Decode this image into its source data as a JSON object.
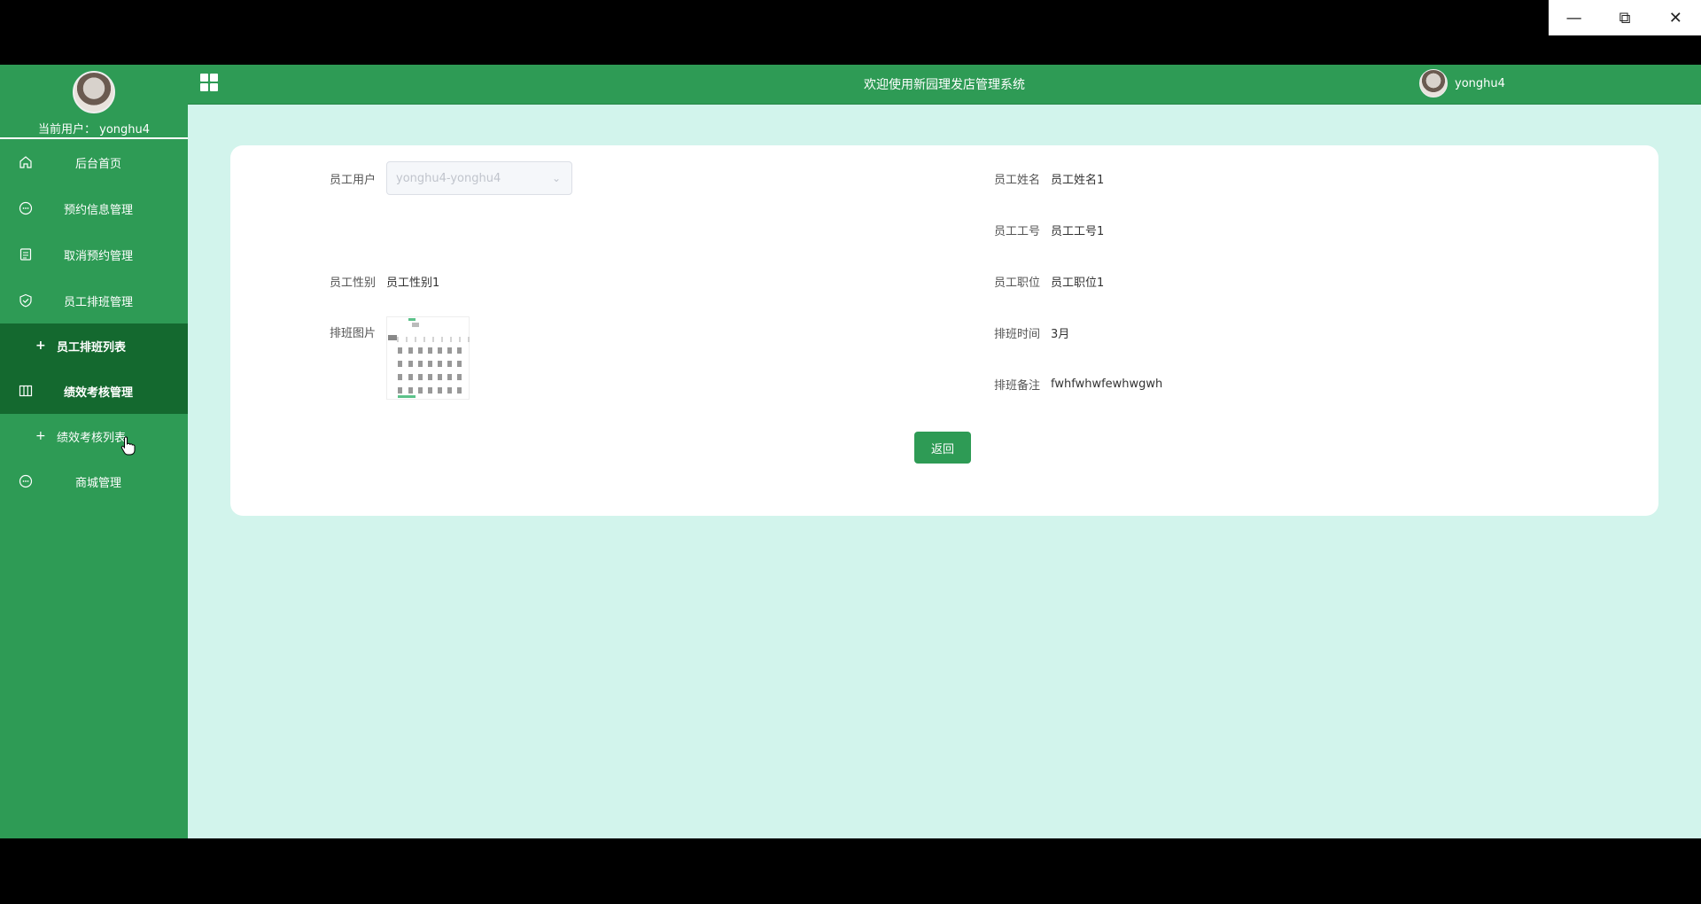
{
  "window": {
    "minimize_icon": "minimize-icon",
    "restore_icon": "restore-icon",
    "close_icon": "close-icon"
  },
  "sidebar": {
    "current_user_label": "当前用户：",
    "current_user": "yonghu4",
    "items": [
      {
        "label": "后台首页",
        "icon": "home-icon"
      },
      {
        "label": "预约信息管理",
        "icon": "chat-icon"
      },
      {
        "label": "取消预约管理",
        "icon": "document-icon"
      },
      {
        "label": "员工排班管理",
        "icon": "shield-icon"
      },
      {
        "label": "员工排班列表",
        "icon": "plus-icon",
        "sub": true
      },
      {
        "label": "绩效考核管理",
        "icon": "columns-icon"
      },
      {
        "label": "绩效考核列表",
        "icon": "plus-icon",
        "sub": true
      },
      {
        "label": "商城管理",
        "icon": "chat-icon"
      }
    ]
  },
  "topbar": {
    "title": "欢迎使用新园理发店管理系统",
    "username": "yonghu4"
  },
  "form": {
    "employee_user": {
      "label": "员工用户",
      "value": "yonghu4-yonghu4"
    },
    "employee_name": {
      "label": "员工姓名",
      "value": "员工姓名1"
    },
    "employee_no": {
      "label": "员工工号",
      "value": "员工工号1"
    },
    "employee_gender": {
      "label": "员工性别",
      "value": "员工性别1"
    },
    "employee_position": {
      "label": "员工职位",
      "value": "员工职位1"
    },
    "schedule_image": {
      "label": "排班图片"
    },
    "schedule_time": {
      "label": "排班时间",
      "value": "3月"
    },
    "schedule_note": {
      "label": "排班备注",
      "value": "fwhfwhwfewhwgwh"
    },
    "back_button": "返回"
  },
  "colors": {
    "primary": "#2e9b55",
    "sidebar_active": "#14692f",
    "content_bg": "#d2f4ec"
  }
}
